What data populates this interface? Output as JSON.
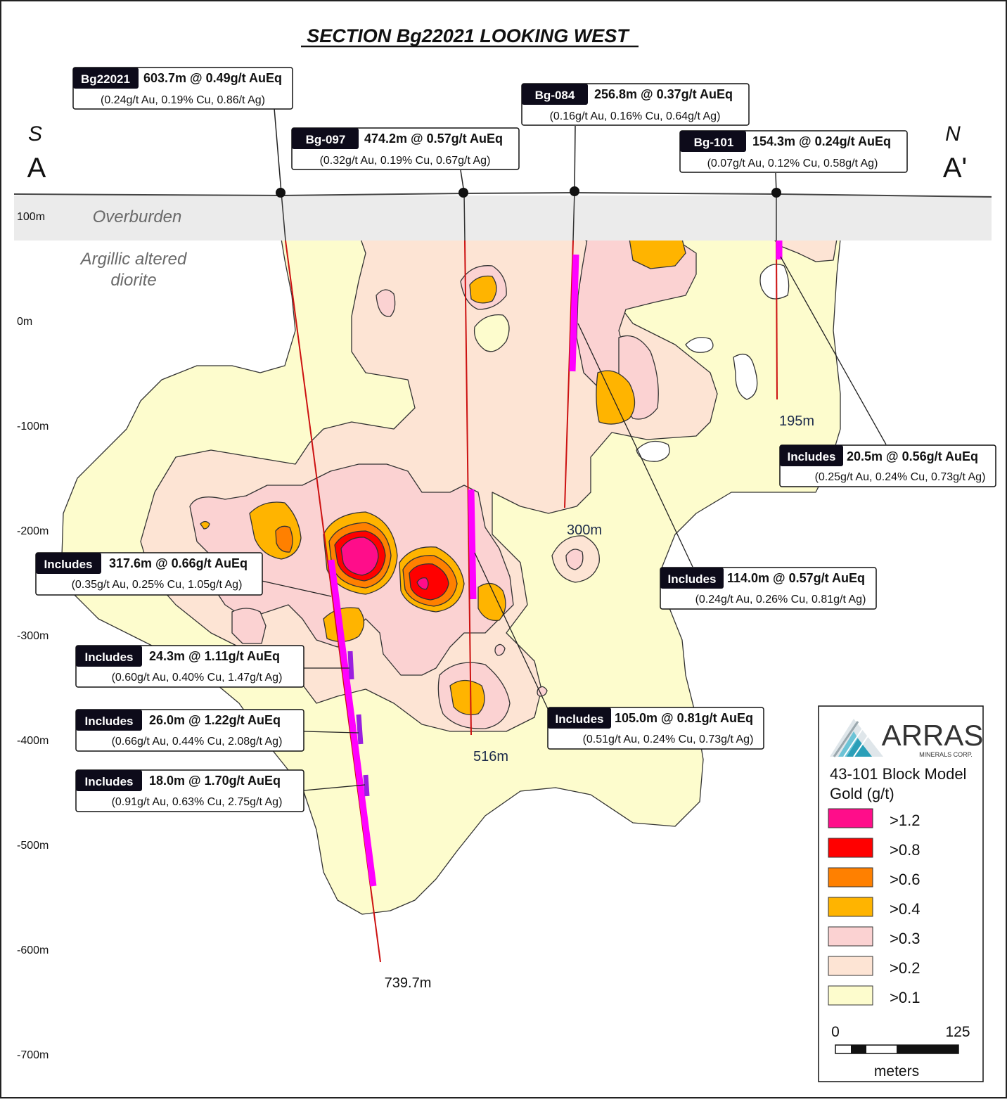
{
  "title": "SECTION Bg22021 LOOKING WEST",
  "orientation": {
    "south_letter": "S",
    "south_marker": "A",
    "north_letter": "N",
    "north_marker": "A'"
  },
  "layers": {
    "overburden": "Overburden",
    "lithology_line1": "Argillic altered",
    "lithology_line2": "diorite"
  },
  "depth_axis": [
    "100m",
    "0m",
    "-100m",
    "-200m",
    "-300m",
    "-400m",
    "-500m",
    "-600m",
    "-700m"
  ],
  "holes": [
    {
      "id": "Bg22021",
      "main": "603.7m @ 0.49g/t AuEq",
      "sub": "(0.24g/t Au, 0.19% Cu, 0.86/t Ag)",
      "end_depth": "739.7m"
    },
    {
      "id": "Bg-097",
      "main": "474.2m @ 0.57g/t AuEq",
      "sub": "(0.32g/t Au, 0.19% Cu, 0.67g/t Ag)",
      "end_depth": "516m"
    },
    {
      "id": "Bg-084",
      "main": "256.8m @ 0.37g/t AuEq",
      "sub": "(0.16g/t Au, 0.16% Cu, 0.64g/t Ag)",
      "end_depth": "300m"
    },
    {
      "id": "Bg-101",
      "main": "154.3m @ 0.24g/t AuEq",
      "sub": "(0.07g/t Au, 0.12% Cu, 0.58g/t Ag)",
      "end_depth": "195m"
    }
  ],
  "intercepts": [
    {
      "tag": "Includes",
      "main": "317.6m @ 0.66g/t AuEq",
      "sub": "(0.35g/t Au, 0.25% Cu, 1.05g/t Ag)"
    },
    {
      "tag": "Includes",
      "main": "24.3m @ 1.11g/t AuEq",
      "sub": "(0.60g/t Au, 0.40% Cu, 1.47g/t Ag)"
    },
    {
      "tag": "Includes",
      "main": "26.0m @ 1.22g/t AuEq",
      "sub": "(0.66g/t Au, 0.44% Cu, 2.08g/t Ag)"
    },
    {
      "tag": "Includes",
      "main": "18.0m @ 1.70g/t AuEq",
      "sub": "(0.91g/t Au, 0.63% Cu, 2.75g/t Ag)"
    },
    {
      "tag": "Includes",
      "main": "105.0m @ 0.81g/t AuEq",
      "sub": "(0.51g/t Au, 0.24% Cu, 0.73g/t Ag)"
    },
    {
      "tag": "Includes",
      "main": "114.0m @ 0.57g/t AuEq",
      "sub": "(0.24g/t Au, 0.26% Cu, 0.81g/t Ag)"
    },
    {
      "tag": "Includes",
      "main": "20.5m @ 0.56g/t AuEq",
      "sub": "(0.25g/t Au, 0.24% Cu, 0.73g/t Ag)"
    }
  ],
  "legend": {
    "company": "ARRAS",
    "company_sub": "MINERALS CORP.",
    "title_line1": "43-101 Block Model",
    "title_line2": "Gold (g/t)",
    "classes": [
      {
        "label": ">1.2",
        "color": "#ff0d8a"
      },
      {
        "label": ">0.8",
        "color": "#ff0000"
      },
      {
        "label": ">0.6",
        "color": "#ff8000"
      },
      {
        "label": ">0.4",
        "color": "#ffb400"
      },
      {
        "label": ">0.3",
        "color": "#fbd2d2"
      },
      {
        "label": ">0.2",
        "color": "#fde4d4"
      },
      {
        "label": ">0.1",
        "color": "#fdfccd"
      }
    ],
    "scale_min": "0",
    "scale_max": "125",
    "scale_unit": "meters"
  },
  "colors": {
    "overburden": "#ebebeb",
    "drill_trace": "#cc1111",
    "intercept_magenta": "#ff00ff",
    "intercept_purple": "#9b1ee0",
    "label_dark": "#0d0b1a"
  }
}
